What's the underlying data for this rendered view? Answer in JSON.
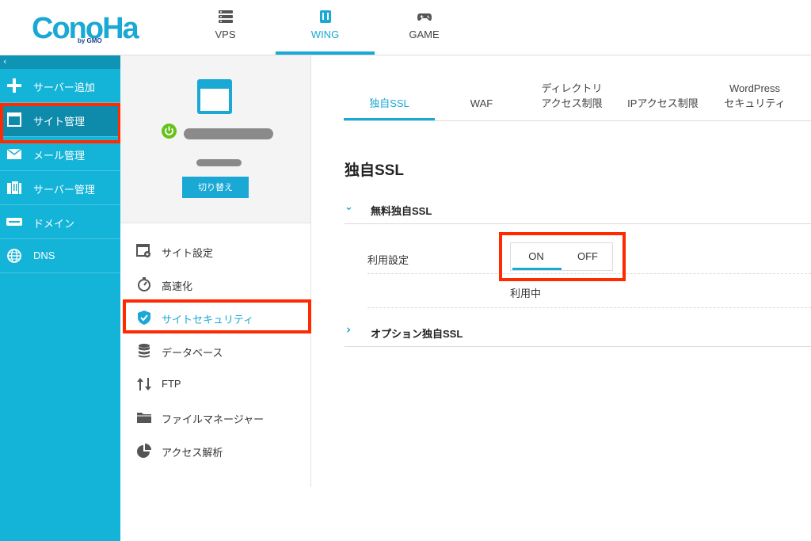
{
  "header": {
    "logo_text": "ConoHa",
    "logo_sub": "by GMO",
    "nav": [
      {
        "label": "VPS",
        "icon": "server-icon"
      },
      {
        "label": "WING",
        "icon": "building-icon",
        "active": true
      },
      {
        "label": "GAME",
        "icon": "gamepad-icon"
      }
    ]
  },
  "sidebar": {
    "collapse": "‹",
    "items": [
      {
        "label": "サーバー追加",
        "icon": "plus-icon"
      },
      {
        "label": "サイト管理",
        "icon": "window-icon",
        "selected": true
      },
      {
        "label": "メール管理",
        "icon": "mail-icon"
      },
      {
        "label": "サーバー管理",
        "icon": "building-icon"
      },
      {
        "label": "ドメイン",
        "icon": "domain-icon"
      },
      {
        "label": "DNS",
        "icon": "globe-icon"
      }
    ]
  },
  "site_panel": {
    "switch_label": "切り替え",
    "menu": [
      {
        "label": "サイト設定",
        "icon": "site-settings-icon"
      },
      {
        "label": "高速化",
        "icon": "stopwatch-icon"
      },
      {
        "label": "サイトセキュリティ",
        "icon": "shield-check-icon",
        "active": true
      },
      {
        "label": "データベース",
        "icon": "database-icon"
      },
      {
        "label": "FTP",
        "icon": "transfer-arrows-icon"
      },
      {
        "label": "ファイルマネージャー",
        "icon": "folder-icon"
      },
      {
        "label": "アクセス解析",
        "icon": "pie-chart-icon"
      }
    ]
  },
  "main": {
    "tabs": [
      {
        "line1": "独自SSL",
        "line2": "",
        "active": true
      },
      {
        "line1": "WAF",
        "line2": ""
      },
      {
        "line1": "ディレクトリ",
        "line2": "アクセス制限"
      },
      {
        "line1": "IPアクセス制限",
        "line2": ""
      },
      {
        "line1": "WordPress",
        "line2": "セキュリティ"
      }
    ],
    "title": "独自SSL",
    "free_ssl": {
      "chevron": "⌄",
      "label": "無料独自SSL",
      "setting_label": "利用設定",
      "toggle_on": "ON",
      "toggle_off": "OFF",
      "status": "利用中"
    },
    "option_ssl": {
      "chevron": "›",
      "label": "オプション独自SSL"
    }
  },
  "colors": {
    "accent": "#1aa8d4",
    "sidebar_bg": "#14b4d8",
    "highlight_border": "#ff2a00",
    "power_green": "#66c21a"
  }
}
